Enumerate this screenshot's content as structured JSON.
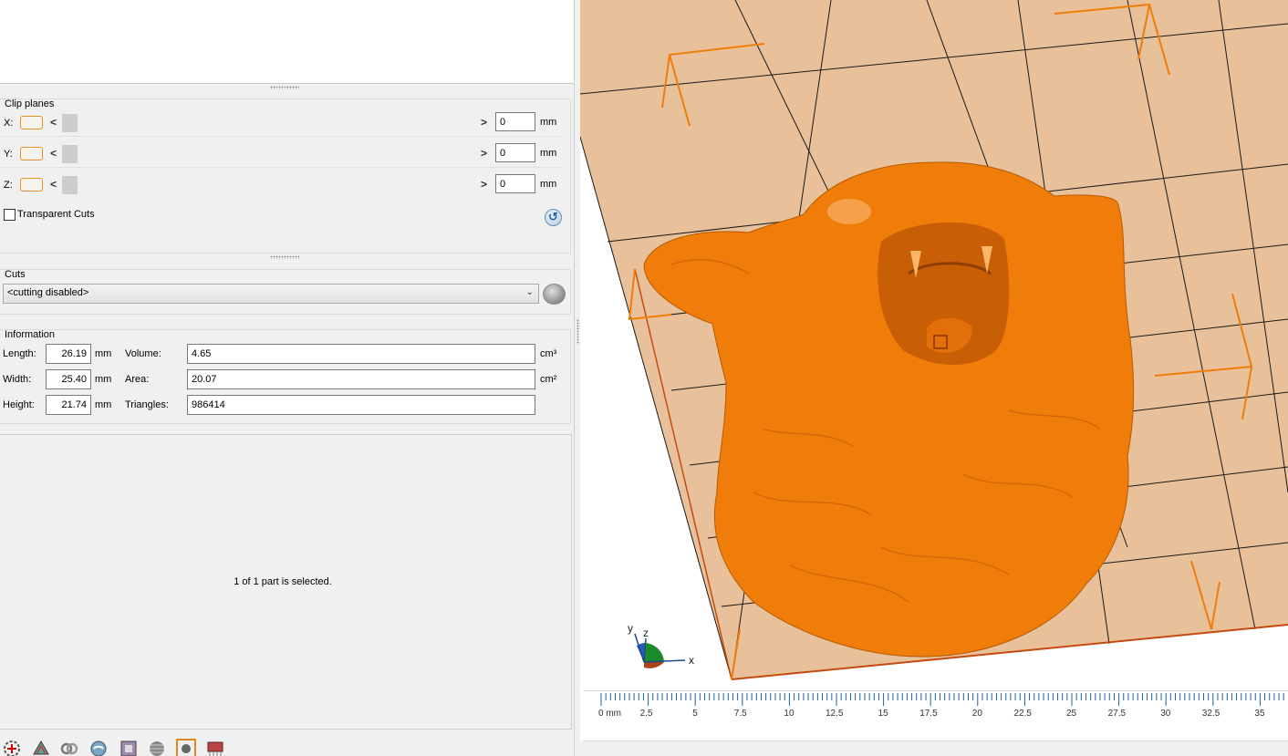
{
  "clip_planes": {
    "title": "Clip planes",
    "rows": [
      {
        "axis": "X:",
        "value": "0",
        "unit": "mm"
      },
      {
        "axis": "Y:",
        "value": "0",
        "unit": "mm"
      },
      {
        "axis": "Z:",
        "value": "0",
        "unit": "mm"
      }
    ],
    "transparent_label": "Transparent Cuts"
  },
  "cuts": {
    "title": "Cuts",
    "selected": "<cutting disabled>"
  },
  "information": {
    "title": "Information",
    "length_label": "Length:",
    "length": "26.19",
    "length_unit": "mm",
    "width_label": "Width:",
    "width": "25.40",
    "width_unit": "mm",
    "height_label": "Height:",
    "height": "21.74",
    "height_unit": "mm",
    "volume_label": "Volume:",
    "volume": "4.65",
    "volume_unit": "cm³",
    "area_label": "Area:",
    "area": "20.07",
    "area_unit": "cm²",
    "triangles_label": "Triangles:",
    "triangles": "986414"
  },
  "status_text": "1 of 1 part is selected.",
  "viewport": {
    "axis_x": "x",
    "axis_y": "y",
    "axis_z": "z",
    "bed_color": "#e8c09a",
    "model_color": "#f07d0a",
    "ruler_labels": [
      "0 mm",
      "2.5",
      "5",
      "7.5",
      "10",
      "12.5",
      "15",
      "17.5",
      "20",
      "22.5",
      "25",
      "27.5",
      "30",
      "32.5",
      "35"
    ]
  },
  "toolbar_icons": [
    "add-part-icon",
    "reduce-icon",
    "wrap-icon",
    "smooth-icon",
    "hollow-icon",
    "shading-icon",
    "select-icon",
    "support-icon"
  ]
}
